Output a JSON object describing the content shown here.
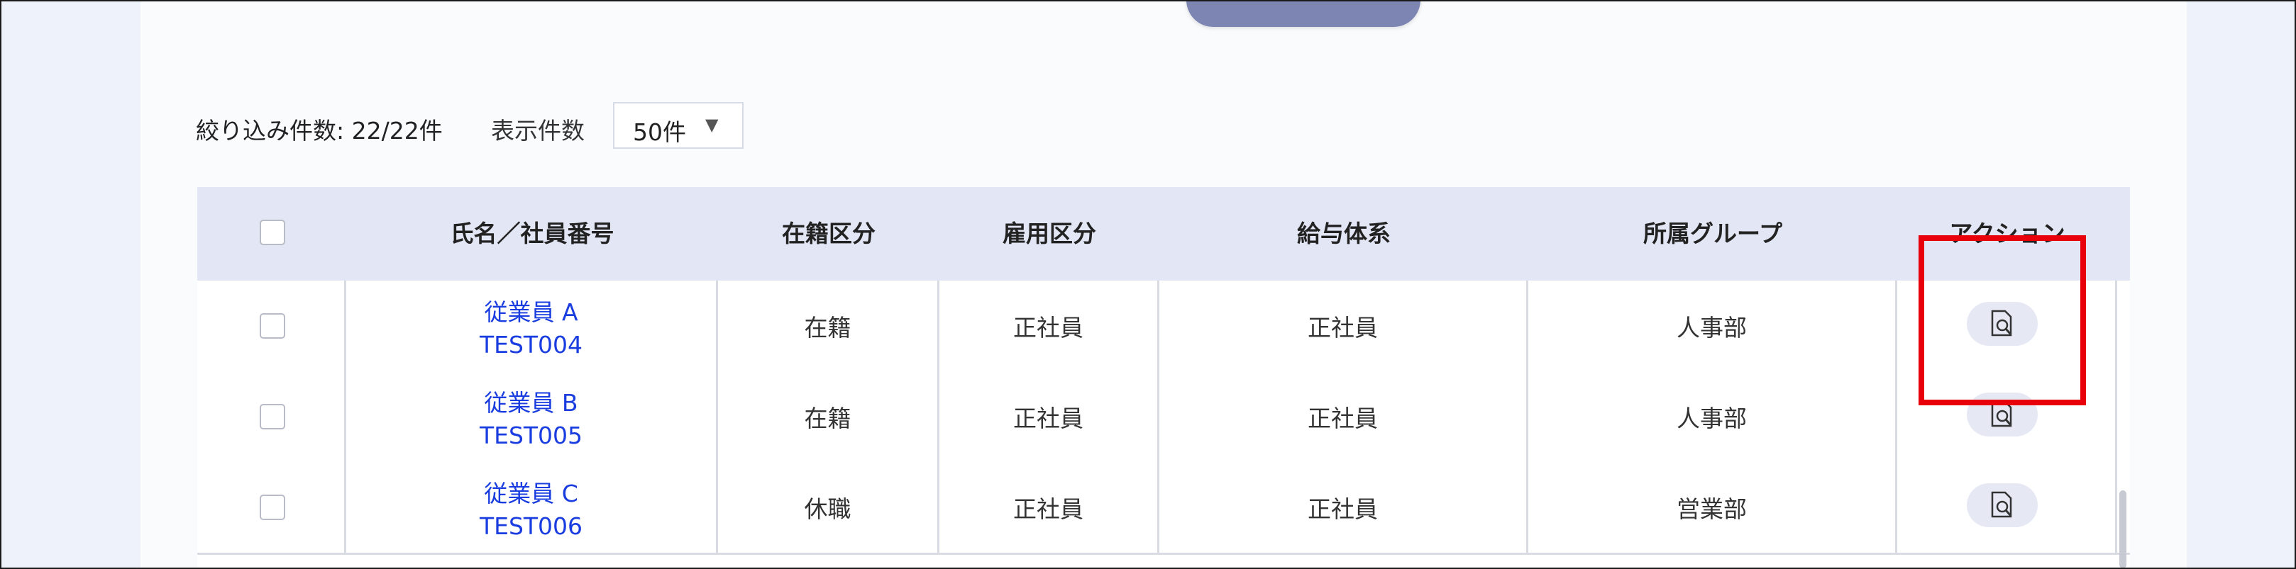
{
  "search_button": {
    "label": ""
  },
  "list_controls": {
    "filter_count": "絞り込み件数: 22/22件",
    "display_label": "表示件数",
    "per_page_value": "50件",
    "caret": "▼"
  },
  "table": {
    "columns": [
      "氏名／社員番号",
      "在籍区分",
      "雇用区分",
      "給与体系",
      "所属グループ",
      "アクション"
    ],
    "rows": [
      {
        "name": "従業員 A",
        "id": "TEST004",
        "enrollment": "在籍",
        "employment": "正社員",
        "pay": "正社員",
        "group": "人事部"
      },
      {
        "name": "従業員 B",
        "id": "TEST005",
        "enrollment": "在籍",
        "employment": "正社員",
        "pay": "正社員",
        "group": "人事部"
      },
      {
        "name": "従業員 C",
        "id": "TEST006",
        "enrollment": "休職",
        "employment": "正社員",
        "pay": "正社員",
        "group": "営業部"
      }
    ]
  },
  "colors": {
    "header_bg": "#e3e6f4",
    "link": "#1a3de0",
    "highlight": "#e8000b"
  }
}
